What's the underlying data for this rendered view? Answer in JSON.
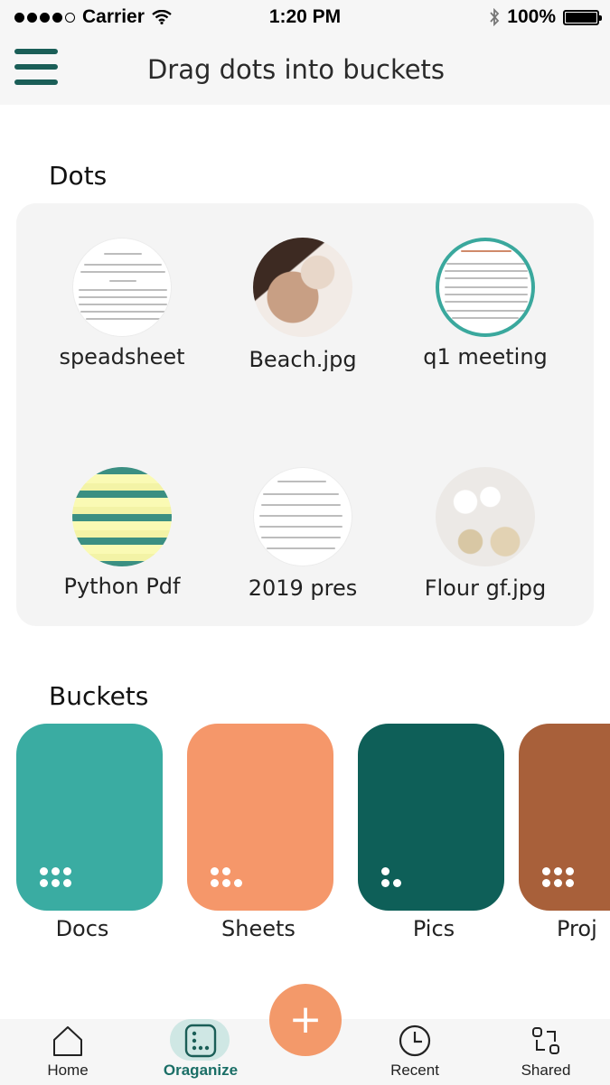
{
  "status_bar": {
    "carrier": "Carrier",
    "time": "1:20 PM",
    "battery": "100%"
  },
  "header": {
    "title": "Drag dots into buckets"
  },
  "sections": {
    "dots_title": "Dots",
    "buckets_title": "Buckets"
  },
  "dots": [
    {
      "label": "speadsheet",
      "thumb": "document"
    },
    {
      "label": "Beach.jpg",
      "thumb": "photo"
    },
    {
      "label": "q1 meeting",
      "thumb": "document"
    },
    {
      "label": "Python Pdf",
      "thumb": "pdf"
    },
    {
      "label": "2019 pres",
      "thumb": "document"
    },
    {
      "label": "Flour gf.jpg",
      "thumb": "photo"
    }
  ],
  "buckets": [
    {
      "label": "Docs",
      "color": "#3aaca2"
    },
    {
      "label": "Sheets",
      "color": "#f5976a"
    },
    {
      "label": "Pics",
      "color": "#0e5f58"
    },
    {
      "label": "Proj",
      "color": "#a8603a"
    }
  ],
  "nav": {
    "items": [
      {
        "label": "Home",
        "icon": "home-icon"
      },
      {
        "label": "Oraganize",
        "icon": "organize-icon",
        "active": true
      },
      {
        "label": "Recent",
        "icon": "clock-icon"
      },
      {
        "label": "Shared",
        "icon": "share-icon"
      }
    ],
    "fab_label": "+"
  }
}
